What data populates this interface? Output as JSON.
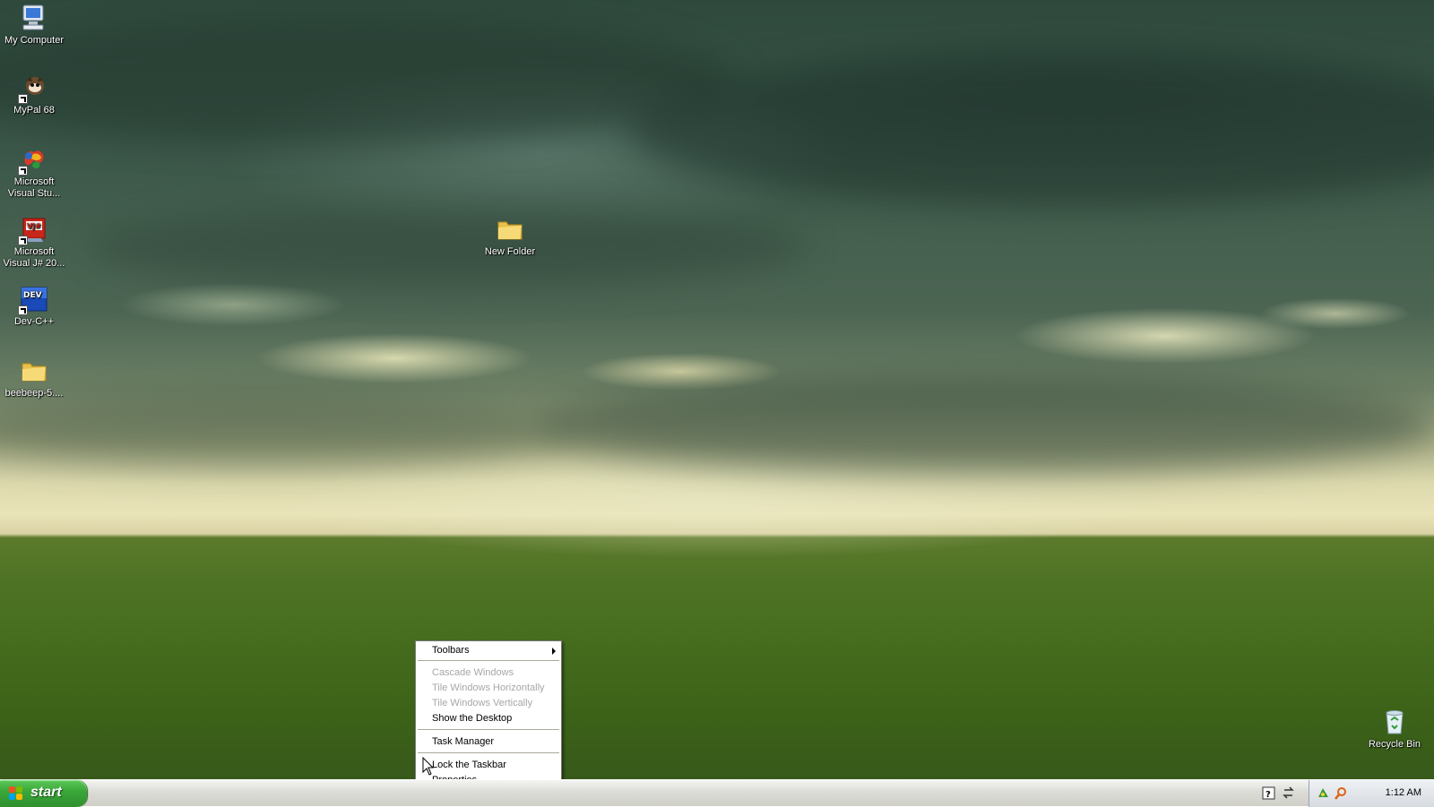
{
  "desktop": {
    "icons": [
      {
        "label": "My Computer",
        "icon": "my-computer-icon"
      },
      {
        "label": "MyPal 68",
        "icon": "mypal-icon"
      },
      {
        "label": "Microsoft Visual Stu...",
        "icon": "visual-studio-icon"
      },
      {
        "label": "Microsoft Visual J# 20...",
        "icon": "visual-jsharp-icon"
      },
      {
        "label": "Dev-C++",
        "icon": "devcpp-icon"
      },
      {
        "label": "beebeep-5....",
        "icon": "folder-icon"
      },
      {
        "label": "New Folder",
        "icon": "folder-icon"
      },
      {
        "label": "Recycle Bin",
        "icon": "recycle-bin-icon"
      }
    ]
  },
  "context_menu": {
    "items": [
      {
        "label": "Toolbars",
        "enabled": true,
        "submenu": true
      },
      {
        "label": "Cascade Windows",
        "enabled": false
      },
      {
        "label": "Tile Windows Horizontally",
        "enabled": false
      },
      {
        "label": "Tile Windows Vertically",
        "enabled": false
      },
      {
        "label": "Show the Desktop",
        "enabled": true
      },
      {
        "label": "Task Manager",
        "enabled": true
      },
      {
        "label": "Lock the Taskbar",
        "enabled": true,
        "checked": true
      },
      {
        "label": "Properties",
        "enabled": true
      }
    ]
  },
  "taskbar": {
    "start_label": "start",
    "clock": "1:12 AM"
  },
  "colors": {
    "start_green": "#3aa83a",
    "menu_disabled": "#a7a6aa",
    "taskbar": "#dcdcd6"
  }
}
